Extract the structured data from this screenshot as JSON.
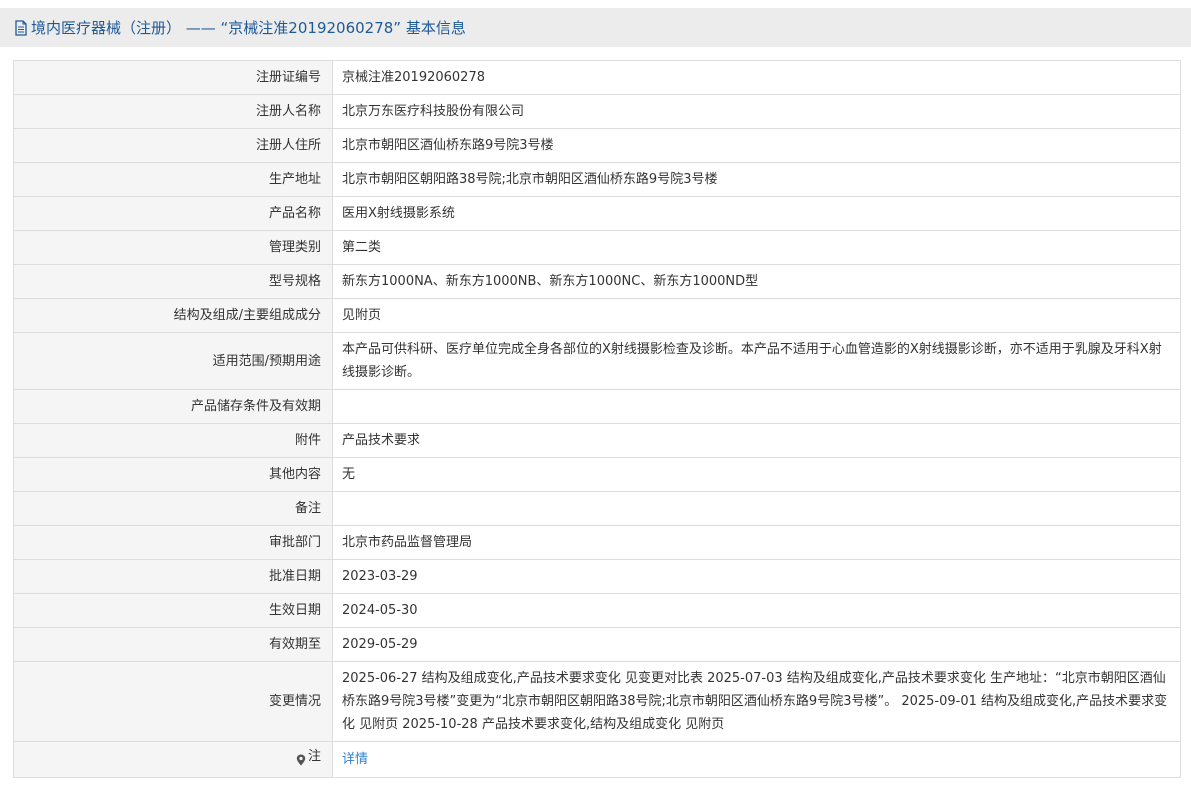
{
  "header": {
    "icon": "document-icon",
    "title": "境内医疗器械（注册） —— “京械注准20192060278” 基本信息",
    "title_color": "#1f5a96"
  },
  "rows": [
    {
      "label": "注册证编号",
      "value": "京械注准20192060278"
    },
    {
      "label": "注册人名称",
      "value": "北京万东医疗科技股份有限公司"
    },
    {
      "label": "注册人住所",
      "value": "北京市朝阳区酒仙桥东路9号院3号楼"
    },
    {
      "label": "生产地址",
      "value": "北京市朝阳区朝阳路38号院;北京市朝阳区酒仙桥东路9号院3号楼"
    },
    {
      "label": "产品名称",
      "value": "医用X射线摄影系统"
    },
    {
      "label": "管理类别",
      "value": "第二类"
    },
    {
      "label": "型号规格",
      "value": "新东方1000NA、新东方1000NB、新东方1000NC、新东方1000ND型"
    },
    {
      "label": "结构及组成/主要组成成分",
      "value": "见附页"
    },
    {
      "label": "适用范围/预期用途",
      "value": "本产品可供科研、医疗单位完成全身各部位的X射线摄影检查及诊断。本产品不适用于心血管造影的X射线摄影诊断，亦不适用于乳腺及牙科X射线摄影诊断。"
    },
    {
      "label": "产品储存条件及有效期",
      "value": ""
    },
    {
      "label": "附件",
      "value": "产品技术要求"
    },
    {
      "label": "其他内容",
      "value": "无"
    },
    {
      "label": "备注",
      "value": ""
    },
    {
      "label": "审批部门",
      "value": "北京市药品监督管理局"
    },
    {
      "label": "批准日期",
      "value": "2023-03-29"
    },
    {
      "label": "生效日期",
      "value": "2024-05-30"
    },
    {
      "label": "有效期至",
      "value": "2029-05-29"
    },
    {
      "label": "变更情况",
      "value": "2025-06-27 结构及组成变化,产品技术要求变化 见变更对比表 2025-07-03 结构及组成变化,产品技术要求变化 生产地址：“北京市朝阳区酒仙桥东路9号院3号楼”变更为“北京市朝阳区朝阳路38号院;北京市朝阳区酒仙桥东路9号院3号楼”。 2025-09-01 结构及组成变化,产品技术要求变化 见附页 2025-10-28 产品技术要求变化,结构及组成变化 见附页"
    }
  ],
  "note": {
    "icon": "location-pin-icon",
    "label": "注",
    "link_text": "详情",
    "link_color": "#2f7fd0"
  }
}
